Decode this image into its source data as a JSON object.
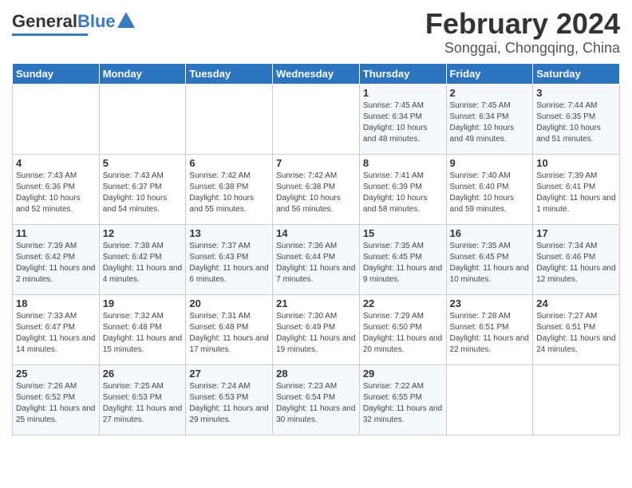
{
  "header": {
    "logo_text_general": "General",
    "logo_text_blue": "Blue",
    "month": "February 2024",
    "location": "Songgai, Chongqing, China"
  },
  "weekdays": [
    "Sunday",
    "Monday",
    "Tuesday",
    "Wednesday",
    "Thursday",
    "Friday",
    "Saturday"
  ],
  "weeks": [
    [
      {
        "day": "",
        "sunrise": "",
        "sunset": "",
        "daylight": ""
      },
      {
        "day": "",
        "sunrise": "",
        "sunset": "",
        "daylight": ""
      },
      {
        "day": "",
        "sunrise": "",
        "sunset": "",
        "daylight": ""
      },
      {
        "day": "",
        "sunrise": "",
        "sunset": "",
        "daylight": ""
      },
      {
        "day": "1",
        "sunrise": "Sunrise: 7:45 AM",
        "sunset": "Sunset: 6:34 PM",
        "daylight": "Daylight: 10 hours and 48 minutes."
      },
      {
        "day": "2",
        "sunrise": "Sunrise: 7:45 AM",
        "sunset": "Sunset: 6:34 PM",
        "daylight": "Daylight: 10 hours and 49 minutes."
      },
      {
        "day": "3",
        "sunrise": "Sunrise: 7:44 AM",
        "sunset": "Sunset: 6:35 PM",
        "daylight": "Daylight: 10 hours and 51 minutes."
      }
    ],
    [
      {
        "day": "4",
        "sunrise": "Sunrise: 7:43 AM",
        "sunset": "Sunset: 6:36 PM",
        "daylight": "Daylight: 10 hours and 52 minutes."
      },
      {
        "day": "5",
        "sunrise": "Sunrise: 7:43 AM",
        "sunset": "Sunset: 6:37 PM",
        "daylight": "Daylight: 10 hours and 54 minutes."
      },
      {
        "day": "6",
        "sunrise": "Sunrise: 7:42 AM",
        "sunset": "Sunset: 6:38 PM",
        "daylight": "Daylight: 10 hours and 55 minutes."
      },
      {
        "day": "7",
        "sunrise": "Sunrise: 7:42 AM",
        "sunset": "Sunset: 6:38 PM",
        "daylight": "Daylight: 10 hours and 56 minutes."
      },
      {
        "day": "8",
        "sunrise": "Sunrise: 7:41 AM",
        "sunset": "Sunset: 6:39 PM",
        "daylight": "Daylight: 10 hours and 58 minutes."
      },
      {
        "day": "9",
        "sunrise": "Sunrise: 7:40 AM",
        "sunset": "Sunset: 6:40 PM",
        "daylight": "Daylight: 10 hours and 59 minutes."
      },
      {
        "day": "10",
        "sunrise": "Sunrise: 7:39 AM",
        "sunset": "Sunset: 6:41 PM",
        "daylight": "Daylight: 11 hours and 1 minute."
      }
    ],
    [
      {
        "day": "11",
        "sunrise": "Sunrise: 7:39 AM",
        "sunset": "Sunset: 6:42 PM",
        "daylight": "Daylight: 11 hours and 2 minutes."
      },
      {
        "day": "12",
        "sunrise": "Sunrise: 7:38 AM",
        "sunset": "Sunset: 6:42 PM",
        "daylight": "Daylight: 11 hours and 4 minutes."
      },
      {
        "day": "13",
        "sunrise": "Sunrise: 7:37 AM",
        "sunset": "Sunset: 6:43 PM",
        "daylight": "Daylight: 11 hours and 6 minutes."
      },
      {
        "day": "14",
        "sunrise": "Sunrise: 7:36 AM",
        "sunset": "Sunset: 6:44 PM",
        "daylight": "Daylight: 11 hours and 7 minutes."
      },
      {
        "day": "15",
        "sunrise": "Sunrise: 7:35 AM",
        "sunset": "Sunset: 6:45 PM",
        "daylight": "Daylight: 11 hours and 9 minutes."
      },
      {
        "day": "16",
        "sunrise": "Sunrise: 7:35 AM",
        "sunset": "Sunset: 6:45 PM",
        "daylight": "Daylight: 11 hours and 10 minutes."
      },
      {
        "day": "17",
        "sunrise": "Sunrise: 7:34 AM",
        "sunset": "Sunset: 6:46 PM",
        "daylight": "Daylight: 11 hours and 12 minutes."
      }
    ],
    [
      {
        "day": "18",
        "sunrise": "Sunrise: 7:33 AM",
        "sunset": "Sunset: 6:47 PM",
        "daylight": "Daylight: 11 hours and 14 minutes."
      },
      {
        "day": "19",
        "sunrise": "Sunrise: 7:32 AM",
        "sunset": "Sunset: 6:48 PM",
        "daylight": "Daylight: 11 hours and 15 minutes."
      },
      {
        "day": "20",
        "sunrise": "Sunrise: 7:31 AM",
        "sunset": "Sunset: 6:48 PM",
        "daylight": "Daylight: 11 hours and 17 minutes."
      },
      {
        "day": "21",
        "sunrise": "Sunrise: 7:30 AM",
        "sunset": "Sunset: 6:49 PM",
        "daylight": "Daylight: 11 hours and 19 minutes."
      },
      {
        "day": "22",
        "sunrise": "Sunrise: 7:29 AM",
        "sunset": "Sunset: 6:50 PM",
        "daylight": "Daylight: 11 hours and 20 minutes."
      },
      {
        "day": "23",
        "sunrise": "Sunrise: 7:28 AM",
        "sunset": "Sunset: 6:51 PM",
        "daylight": "Daylight: 11 hours and 22 minutes."
      },
      {
        "day": "24",
        "sunrise": "Sunrise: 7:27 AM",
        "sunset": "Sunset: 6:51 PM",
        "daylight": "Daylight: 11 hours and 24 minutes."
      }
    ],
    [
      {
        "day": "25",
        "sunrise": "Sunrise: 7:26 AM",
        "sunset": "Sunset: 6:52 PM",
        "daylight": "Daylight: 11 hours and 25 minutes."
      },
      {
        "day": "26",
        "sunrise": "Sunrise: 7:25 AM",
        "sunset": "Sunset: 6:53 PM",
        "daylight": "Daylight: 11 hours and 27 minutes."
      },
      {
        "day": "27",
        "sunrise": "Sunrise: 7:24 AM",
        "sunset": "Sunset: 6:53 PM",
        "daylight": "Daylight: 11 hours and 29 minutes."
      },
      {
        "day": "28",
        "sunrise": "Sunrise: 7:23 AM",
        "sunset": "Sunset: 6:54 PM",
        "daylight": "Daylight: 11 hours and 30 minutes."
      },
      {
        "day": "29",
        "sunrise": "Sunrise: 7:22 AM",
        "sunset": "Sunset: 6:55 PM",
        "daylight": "Daylight: 11 hours and 32 minutes."
      },
      {
        "day": "",
        "sunrise": "",
        "sunset": "",
        "daylight": ""
      },
      {
        "day": "",
        "sunrise": "",
        "sunset": "",
        "daylight": ""
      }
    ]
  ]
}
